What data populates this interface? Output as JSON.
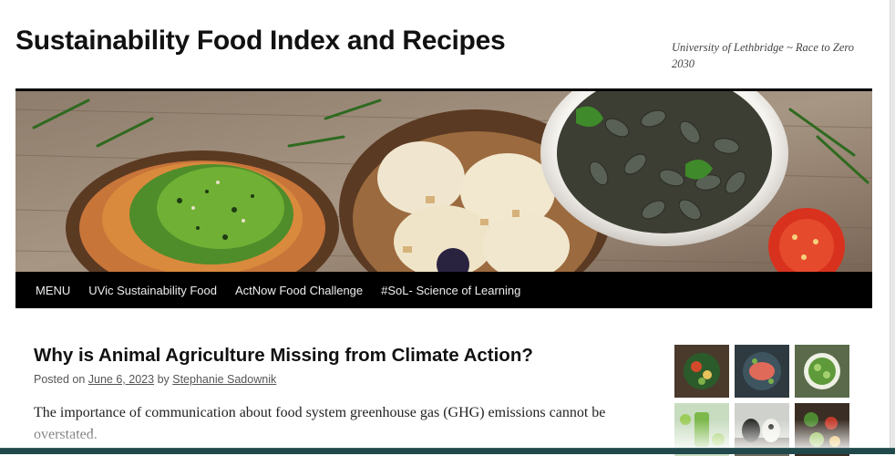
{
  "site": {
    "title": "Sustainability Food Index and Recipes",
    "tagline": "University of Lethbridge ~ Race to Zero 2030"
  },
  "nav": {
    "items": [
      {
        "label": "MENU"
      },
      {
        "label": "UVic Sustainability Food"
      },
      {
        "label": "ActNow Food Challenge"
      },
      {
        "label": "#SoL- Science of Learning"
      }
    ]
  },
  "post": {
    "title": "Why is Animal Agriculture Missing from Climate Action?",
    "meta_posted_on": "Posted on",
    "date": "June 6, 2023",
    "meta_by": "by",
    "author": "Stephanie Sadownik",
    "excerpt": "The importance of communication about food system greenhouse gas (GHG) emissions cannot be overstated."
  },
  "sidebar": {
    "thumbnails": [
      {
        "icon": "salad-bowl-image"
      },
      {
        "icon": "salmon-plate-image"
      },
      {
        "icon": "greens-bowl-image"
      },
      {
        "icon": "green-juice-image"
      },
      {
        "icon": "cattle-image"
      },
      {
        "icon": "vegetables-image"
      }
    ]
  },
  "colors": {
    "nav_background": "#000000",
    "nav_text": "#eeeeee",
    "title_text": "#111111",
    "bottom_bar": "#21484b"
  }
}
